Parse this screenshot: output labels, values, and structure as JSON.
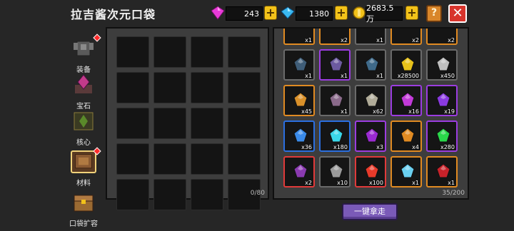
{
  "header": {
    "title": "拉吉酱次元口袋"
  },
  "currency": {
    "pink_gem": "243",
    "blue_gem": "1380",
    "coins": "2683.5万",
    "plus_label": "+"
  },
  "controls": {
    "help_label": "?",
    "close_label": "✕"
  },
  "sidebar": {
    "items": [
      {
        "label": "装备",
        "icon": "armor-icon",
        "badge": true
      },
      {
        "label": "宝石",
        "icon": "gem-icon",
        "badge": false
      },
      {
        "label": "核心",
        "icon": "core-icon",
        "badge": false
      },
      {
        "label": "材料",
        "icon": "materials-icon",
        "badge": true,
        "active": true
      },
      {
        "label": "口袋扩容",
        "icon": "chest-icon",
        "badge": false
      }
    ]
  },
  "left_panel": {
    "counter": "0/80"
  },
  "right_panel": {
    "counter": "35/200",
    "top_partial_qty": [
      "x1",
      "x2",
      "x1",
      "x2",
      "x2"
    ],
    "items": [
      {
        "icon": "wrench-icon",
        "qty": "x1",
        "quality": "gray",
        "color": "#3f5d78"
      },
      {
        "icon": "badge-icon",
        "qty": "x1",
        "quality": "purple",
        "color": "#6c5aa0"
      },
      {
        "icon": "stone-tablet-icon",
        "qty": "x1",
        "quality": "gray",
        "color": "#3f6a8a"
      },
      {
        "icon": "gold-coin-icon",
        "qty": "x28500",
        "quality": "gray",
        "color": "#e8c21a"
      },
      {
        "icon": "ore-pile-icon",
        "qty": "x450",
        "quality": "gray",
        "color": "#bfbfbf"
      },
      {
        "icon": "dust-pile-icon",
        "qty": "x45",
        "quality": "orange",
        "color": "#d9902a"
      },
      {
        "icon": "crossbow-icon",
        "qty": "x1",
        "quality": "gray",
        "color": "#8a6a8a"
      },
      {
        "icon": "stone-icon",
        "qty": "x62",
        "quality": "gray",
        "color": "#b0ab98"
      },
      {
        "icon": "purple-shard-icon",
        "qty": "x16",
        "quality": "purple",
        "color": "#c23ad8"
      },
      {
        "icon": "purple-crystal-icon",
        "qty": "x19",
        "quality": "purple",
        "color": "#8a3ae0"
      },
      {
        "icon": "blue-crystal-icon",
        "qty": "x36",
        "quality": "blue",
        "color": "#3a8ae8"
      },
      {
        "icon": "cyan-star-icon",
        "qty": "x180",
        "quality": "blue",
        "color": "#3ad8e8"
      },
      {
        "icon": "purple-orb-icon",
        "qty": "x3",
        "quality": "purple",
        "color": "#9a2ad0"
      },
      {
        "icon": "orange-crystal-icon",
        "qty": "x4",
        "quality": "orange",
        "color": "#e08a22"
      },
      {
        "icon": "green-star-icon",
        "qty": "x280",
        "quality": "purple",
        "color": "#2ad84a"
      },
      {
        "icon": "potion-icon",
        "qty": "x2",
        "quality": "red",
        "color": "#8a3ab0"
      },
      {
        "icon": "gray-rocks-icon",
        "qty": "x10",
        "quality": "gray",
        "color": "#9a9a9a"
      },
      {
        "icon": "red-star-icon",
        "qty": "x100",
        "quality": "red",
        "color": "#e83a2a"
      },
      {
        "icon": "ice-crystal-icon",
        "qty": "x1",
        "quality": "orange",
        "color": "#6ad0f0"
      },
      {
        "icon": "red-plant-icon",
        "qty": "x1",
        "quality": "orange",
        "color": "#c8222a"
      }
    ]
  },
  "actions": {
    "take_all_label": "一键拿走"
  }
}
